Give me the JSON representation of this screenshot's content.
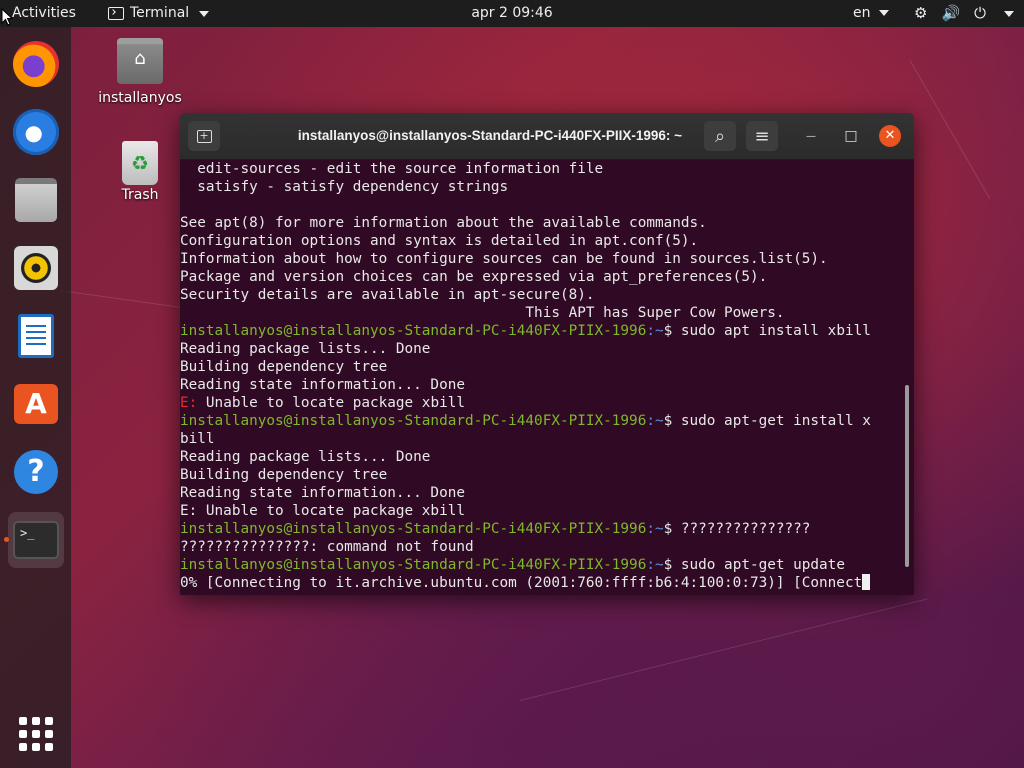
{
  "topbar": {
    "activities": "Activities",
    "app_name": "Terminal",
    "clock": "apr 2  09:46",
    "language": "en"
  },
  "dock": {
    "items": [
      {
        "name": "Firefox",
        "icon": "firefox-icon"
      },
      {
        "name": "Thunderbird",
        "icon": "thunderbird-icon"
      },
      {
        "name": "Files",
        "icon": "files-icon"
      },
      {
        "name": "Rhythmbox",
        "icon": "rhythmbox-icon"
      },
      {
        "name": "LibreOffice Writer",
        "icon": "writer-icon"
      },
      {
        "name": "Ubuntu Software",
        "icon": "software-icon"
      },
      {
        "name": "Help",
        "icon": "help-icon"
      },
      {
        "name": "Terminal",
        "icon": "terminal-icon",
        "active": true
      }
    ],
    "store_glyph": "A",
    "help_glyph": "?",
    "terminal_glyph": ">_"
  },
  "desktop": {
    "home_label": "installanyos",
    "trash_label": "Trash",
    "trash_glyph": "♻"
  },
  "window": {
    "title": "installanyos@installanyos-Standard-PC-i440FX-PIIX-1996: ~",
    "close_glyph": "✕",
    "minimize_glyph": "—",
    "maximize_glyph": "□",
    "menu_glyph": "≡",
    "search_glyph": "⌕",
    "newtab_glyph": "+"
  },
  "terminal": {
    "user_host": "installanyos@installanyos-Standard-PC-i440FX-PIIX-1996",
    "path": ":~",
    "lines": {
      "l1": "  edit-sources - edit the source information file",
      "l2": "  satisfy - satisfy dependency strings",
      "l3": "",
      "l4": "See apt(8) for more information about the available commands.",
      "l5": "Configuration options and syntax is detailed in apt.conf(5).",
      "l6": "Information about how to configure sources can be found in sources.list(5).",
      "l7": "Package and version choices can be expressed via apt_preferences(5).",
      "l8": "Security details are available in apt-secure(8).",
      "l9": "                                        This APT has Super Cow Powers.",
      "cmd1": "$ sudo apt install xbill",
      "l11": "Reading package lists... Done",
      "l12": "Building dependency tree",
      "l13": "Reading state information... Done",
      "err_prefix": "E:",
      "l14": " Unable to locate package xbill",
      "cmd2": "$ sudo apt-get install x",
      "l16": "bill",
      "l17": "Reading package lists... Done",
      "l18": "Building dependency tree",
      "l19": "Reading state information... Done",
      "l20": "E: Unable to locate package xbill",
      "cmd3": "$ ???????????????",
      "l22": "???????????????: command not found",
      "cmd4": "$ sudo apt-get update",
      "l24": "0% [Connecting to it.archive.ubuntu.com (2001:760:ffff:b6:4:100:0:73)] [Connect"
    }
  }
}
